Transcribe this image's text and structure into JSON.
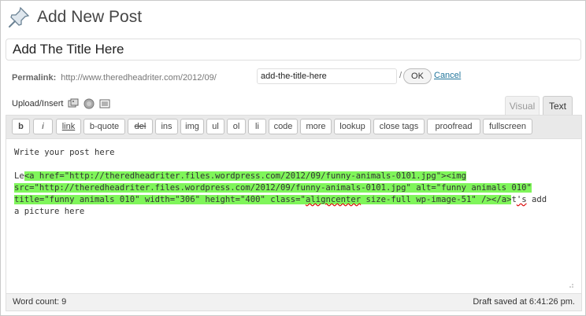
{
  "header": {
    "title": "Add New Post",
    "icon": "pushpin-icon"
  },
  "post": {
    "title_value": "Add The Title Here"
  },
  "permalink": {
    "label": "Permalink:",
    "base": "http://www.theredheadriter.com/2012/09/",
    "slug_value": "add-the-title-here",
    "slash": "/",
    "ok_label": "OK",
    "cancel_label": "Cancel"
  },
  "media": {
    "label": "Upload/Insert",
    "icons": [
      "add-media-icon",
      "add-video-icon",
      "add-media-library-icon"
    ]
  },
  "tabs": {
    "visual": "Visual",
    "text": "Text"
  },
  "quicktags": [
    {
      "label": "b"
    },
    {
      "label": "i"
    },
    {
      "label": "link"
    },
    {
      "label": "b-quote"
    },
    {
      "label": "del"
    },
    {
      "label": "ins"
    },
    {
      "label": "img"
    },
    {
      "label": "ul"
    },
    {
      "label": "ol"
    },
    {
      "label": "li"
    },
    {
      "label": "code"
    },
    {
      "label": "more"
    },
    {
      "label": "lookup"
    },
    {
      "label": "close tags"
    },
    {
      "label": "proofread"
    },
    {
      "label": "fullscreen"
    }
  ],
  "content": {
    "line1": "Write your post here",
    "line2_pre": "Le",
    "line2_hl": "<a href=\"http://theredheadriter.files.wordpress.com/2012/09/funny-animals-0101.jpg\"><img",
    "line3_hl": "src=\"http://theredheadriter.files.wordpress.com/2012/09/funny-animals-0101.jpg\" alt=\"funny animals 010\"",
    "line4_hl_a": "title=\"funny animals 010\" width=\"306\" height=\"400\" class=\"",
    "line4_squig": "aligncenter",
    "line4_hl_b": " size-full wp-image-51\" /></a>",
    "line4_post_a": "t",
    "line4_post_squig": "'s",
    "line4_post_b": " add",
    "line5": "a picture here"
  },
  "status": {
    "word_count": "Word count: 9",
    "draft_saved": "Draft saved at 6:41:26 pm."
  },
  "colors": {
    "highlight": "#7ff55a",
    "link": "#21759b",
    "title_text": "#464646"
  }
}
